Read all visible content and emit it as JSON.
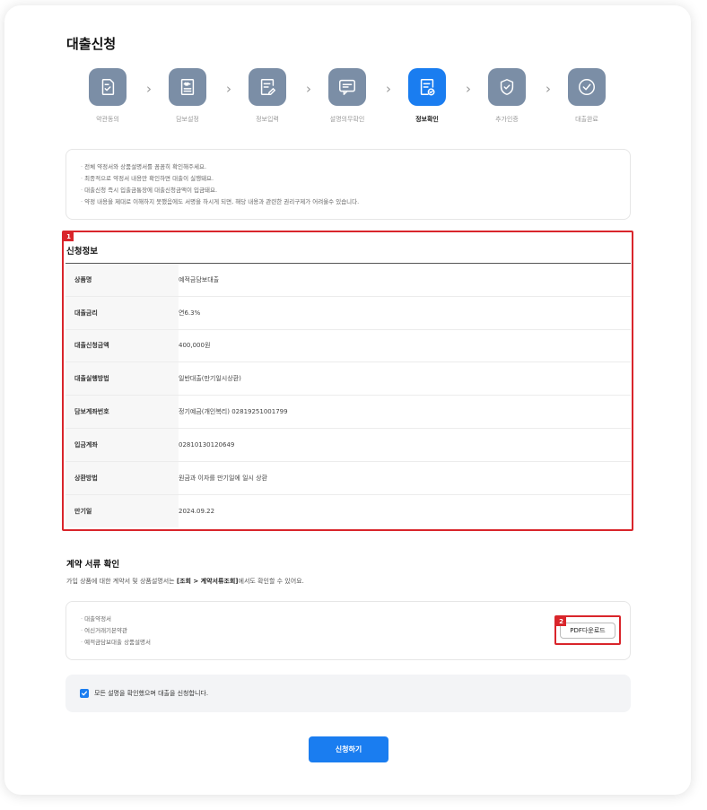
{
  "page": {
    "title": "대출신청"
  },
  "steps": [
    {
      "label": "약관동의",
      "icon": "document-check-icon"
    },
    {
      "label": "담보설정",
      "icon": "won-document-icon"
    },
    {
      "label": "정보입력",
      "icon": "document-edit-icon"
    },
    {
      "label": "설명의무확인",
      "icon": "message-icon"
    },
    {
      "label": "정보확인",
      "icon": "document-verify-icon",
      "active": true
    },
    {
      "label": "추가인증",
      "icon": "shield-check-icon"
    },
    {
      "label": "대출완료",
      "icon": "circle-check-icon"
    }
  ],
  "notice": {
    "items": [
      "전체 약정서와 상품설명서를 꼼꼼히 확인해주세요.",
      "최종적으로 약정서 내용만 확인하면 대출이 실행돼요.",
      "대출신청 즉시 입출금통장에 대출신청금액이 입금돼요.",
      "약정 내용을 제대로 이해하지 못했음에도 서명을 하시게 되면, 해당 내용과 관련한 권리구제가 어려울수 있습니다."
    ]
  },
  "info": {
    "title": "신청정보",
    "rows": [
      {
        "label": "상품명",
        "value": "예적금담보대출"
      },
      {
        "label": "대출금리",
        "value": "연6.3%"
      },
      {
        "label": "대출신청금액",
        "value": "400,000원"
      },
      {
        "label": "대출실행방법",
        "value": "일반대출(만기일시상환)"
      },
      {
        "label": "담보계좌번호",
        "value": "정기예금(개인복리) 02819251001799"
      },
      {
        "label": "입금계좌",
        "value": "02810130120649"
      },
      {
        "label": "상환방법",
        "value": "원금과 이자를 만기일에 일시 상환"
      },
      {
        "label": "만기일",
        "value": "2024.09.22"
      }
    ]
  },
  "docs": {
    "title": "계약 서류 확인",
    "desc_prefix": "가입 상품에 대한 계약서 및 상품설명서는 ",
    "desc_bold": "[조회 > 계약서류조회]",
    "desc_suffix": "에서도 확인할 수 있어요.",
    "items": [
      "대출약정서",
      "여신거래기본약관",
      "예적금담보대출 상품설명서"
    ],
    "pdf_button": "PDF다운로드"
  },
  "agree": {
    "label": "모든 설명을 확인했으며 대출을 신청합니다.",
    "checked": true
  },
  "submit": {
    "label": "신청하기"
  },
  "annotations": {
    "tag1": "1",
    "tag2": "2"
  },
  "colors": {
    "accent": "#1a7df0",
    "step_inactive": "#7b8ea6",
    "highlight": "#d9252b"
  }
}
